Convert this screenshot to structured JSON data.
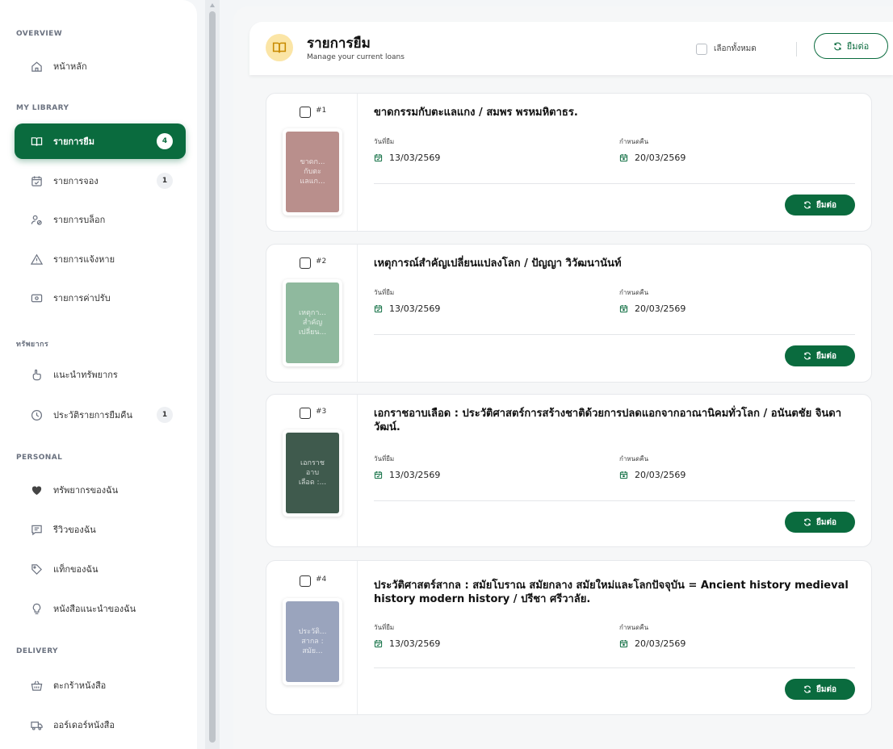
{
  "sidebar": {
    "sections": [
      {
        "title": "OVERVIEW"
      },
      {
        "title": "MY LIBRARY"
      },
      {
        "title": "ทรัพยากร"
      },
      {
        "title": "PERSONAL"
      },
      {
        "title": "DELIVERY"
      }
    ],
    "items": [
      {
        "label": "หน้าหลัก",
        "icon": "home-icon"
      },
      {
        "label": "รายการยืม",
        "icon": "book-open-icon",
        "count": "4",
        "active": true
      },
      {
        "label": "รายการจอง",
        "icon": "calendar-check-icon",
        "count": "1"
      },
      {
        "label": "รายการบล็อก",
        "icon": "users-block-icon"
      },
      {
        "label": "รายการแจ้งหาย",
        "icon": "warning-icon"
      },
      {
        "label": "รายการค่าปรับ",
        "icon": "money-icon"
      },
      {
        "label": "แนะนำทรัพยากร",
        "icon": "hand-point-icon"
      },
      {
        "label": "ประวัติรายการยืมคืน",
        "icon": "history-icon",
        "count": "1"
      },
      {
        "label": "ทรัพยากรของฉัน",
        "icon": "heart-icon"
      },
      {
        "label": "รีวิวของฉัน",
        "icon": "review-icon"
      },
      {
        "label": "แท็กของฉัน",
        "icon": "tag-icon"
      },
      {
        "label": "หนังสือแนะนำของฉัน",
        "icon": "lightbulb-icon"
      },
      {
        "label": "ตะกร้าหนังสือ",
        "icon": "basket-icon"
      },
      {
        "label": "ออร์เดอร์หนังสือ",
        "icon": "truck-icon"
      }
    ]
  },
  "header": {
    "icon": "book-open-icon",
    "title": "รายการยืม",
    "subtitle": "Manage your current loans",
    "select_all_label": "เลือกทั้งหมด",
    "renew_all_label": "ยืมต่อ"
  },
  "loans": [
    {
      "number": "#1",
      "title": "ขาดกรรมกับตะแลแกง / สมพร พรหมหิตาธร.",
      "cover_text": "ขาดก...\nกับตะ\nแลแก...",
      "cover_color": "#b98f8c",
      "borrow_label": "วันที่ยืม",
      "borrow_date": "13/03/2569",
      "due_label": "กำหนดคืน",
      "due_date": "20/03/2569",
      "renew_label": "ยืมต่อ"
    },
    {
      "number": "#2",
      "title": "เหตุการณ์สำคัญเปลี่ยนแปลงโลก / ปัญญา วิวัฒนานันท์",
      "cover_text": "เหตุกา...\nสำคัญ\nเปลี่ยน...",
      "cover_color": "#8fb99e",
      "borrow_label": "วันที่ยืม",
      "borrow_date": "13/03/2569",
      "due_label": "กำหนดคืน",
      "due_date": "20/03/2569",
      "renew_label": "ยืมต่อ"
    },
    {
      "number": "#3",
      "title": "เอกราชอาบเลือด : ประวัติศาสตร์การสร้างชาติด้วยการปลดแอกจากอาณานิคมทั่วโลก / อนันตชัย จินดาวัฒน์.",
      "cover_text": "เอกราช\nอาบ\nเลือด :...",
      "cover_color": "#3f5a4d",
      "borrow_label": "วันที่ยืม",
      "borrow_date": "13/03/2569",
      "due_label": "กำหนดคืน",
      "due_date": "20/03/2569",
      "renew_label": "ยืมต่อ"
    },
    {
      "number": "#4",
      "title": "ประวัติศาสตร์สากล : สมัยโบราณ สมัยกลาง สมัยใหม่และโลกปัจจุบัน = Ancient history medieval history modern history / ปรีชา ศรีวาลัย.",
      "cover_text": "ประวัติ...\nสากล :\nสมัย...",
      "cover_color": "#9aa4bd",
      "borrow_label": "วันที่ยืม",
      "borrow_date": "13/03/2569",
      "due_label": "กำหนดคืน",
      "due_date": "20/03/2569",
      "renew_label": "ยืมต่อ"
    }
  ],
  "colors": {
    "accent": "#0a6b3e",
    "header_icon_bg": "#fbe5a6"
  }
}
